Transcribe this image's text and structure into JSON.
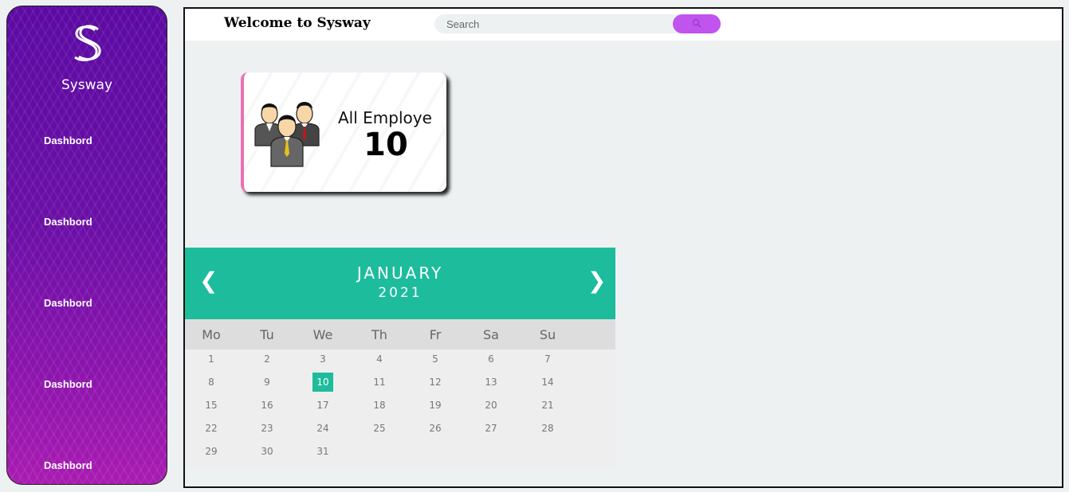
{
  "sidebar": {
    "brand": "Sysway",
    "items": [
      {
        "label": "Dashbord"
      },
      {
        "label": "Dashbord"
      },
      {
        "label": "Dashbord"
      },
      {
        "label": "Dashbord"
      },
      {
        "label": "Dashbord"
      }
    ]
  },
  "header": {
    "title": "Welcome to Sysway",
    "search_placeholder": "Search",
    "search_icon": "search-icon"
  },
  "card": {
    "title": "All Employe",
    "count": "10",
    "icon": "employees-icon",
    "accent": "#ea6fb5"
  },
  "calendar": {
    "month": "JANUARY",
    "year": "2021",
    "prev": "❮",
    "next": "❯",
    "weekdays": [
      "Mo",
      "Tu",
      "We",
      "Th",
      "Fr",
      "Sa",
      "Su"
    ],
    "days": [
      "1",
      "2",
      "3",
      "4",
      "5",
      "6",
      "7",
      "8",
      "9",
      "10",
      "11",
      "12",
      "13",
      "14",
      "15",
      "16",
      "17",
      "18",
      "19",
      "20",
      "21",
      "22",
      "23",
      "24",
      "25",
      "26",
      "27",
      "28",
      "29",
      "30",
      "31"
    ],
    "active_day": "10",
    "accent": "#1dbc9c"
  },
  "colors": {
    "sidebar": "#6a0fa6",
    "search_button": "#c153ee"
  }
}
